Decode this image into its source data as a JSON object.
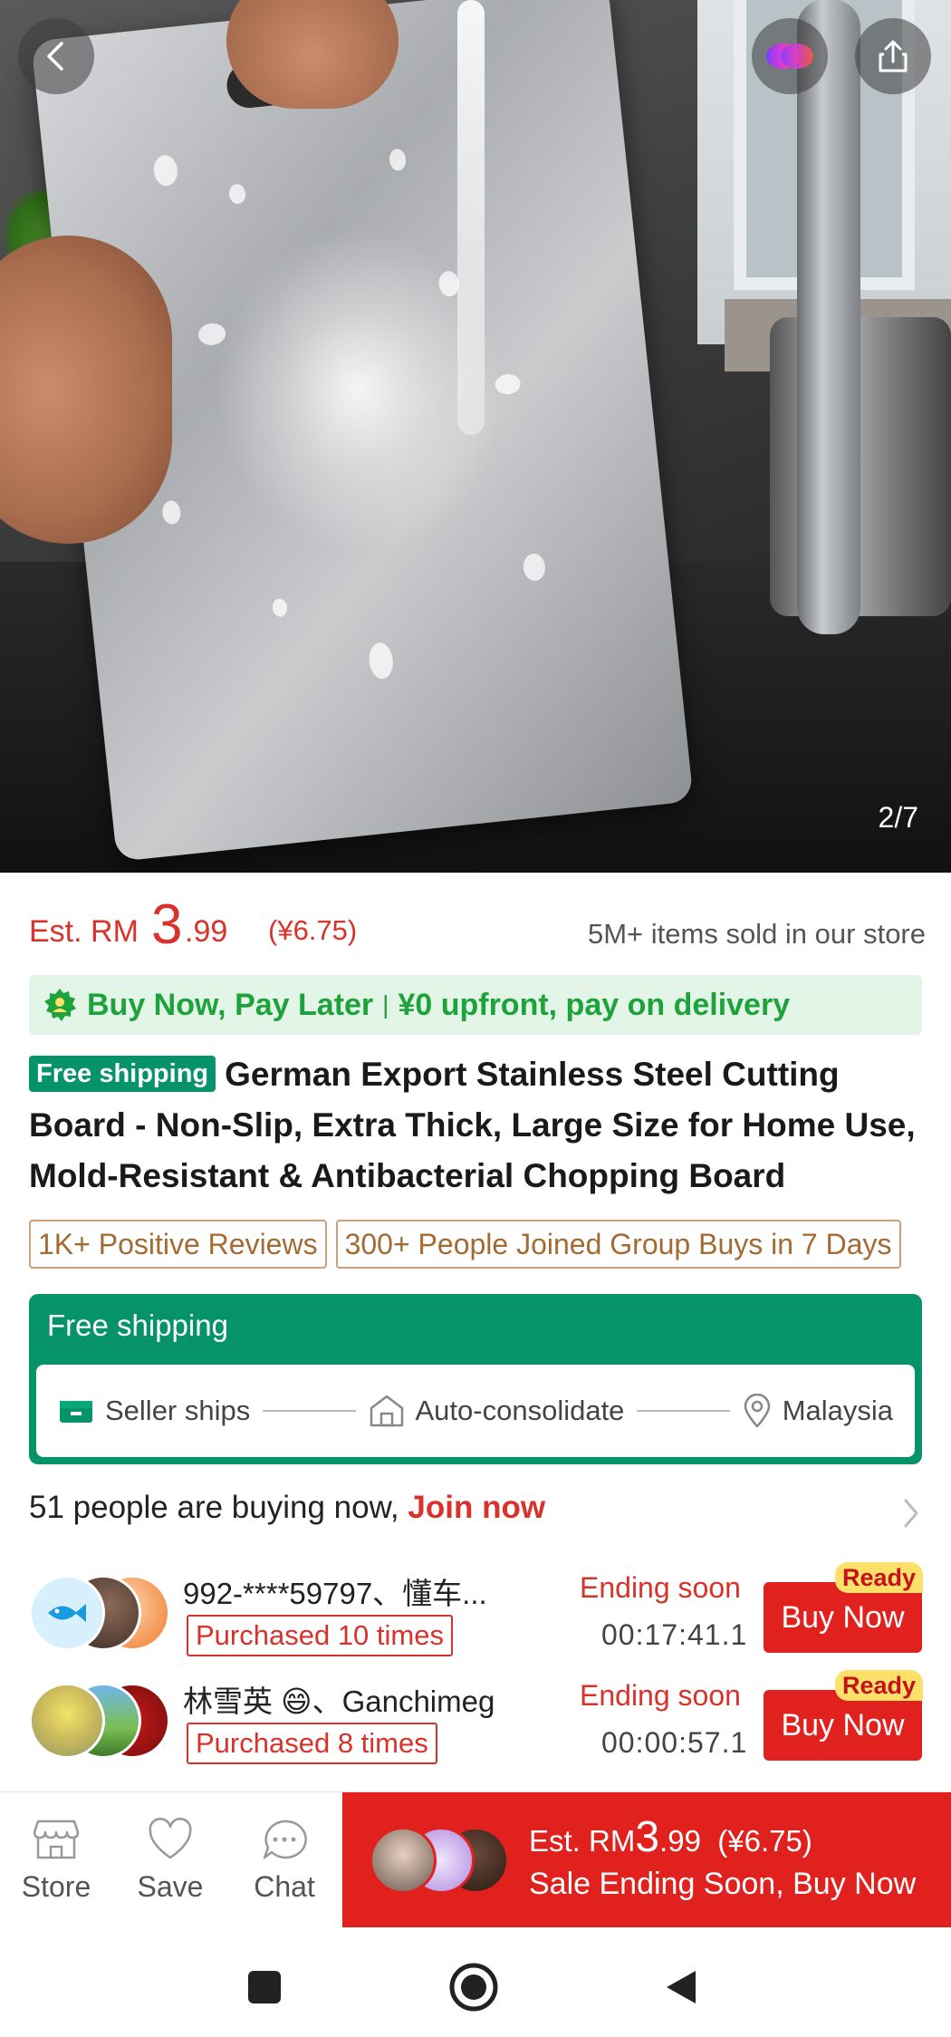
{
  "gallery": {
    "counter": "2/7"
  },
  "price": {
    "est_prefix": "Est. RM",
    "integer": "3",
    "decimal": ".99",
    "cny": "(¥6.75)",
    "sold": "5M+ items sold in our store"
  },
  "bnpl": {
    "part1": "Buy Now, Pay Later",
    "separator": "|",
    "part2": "¥0 upfront, pay on delivery"
  },
  "product": {
    "badge": "Free shipping",
    "title": "German Export Stainless Steel Cutting Board - Non-Slip, Extra Thick, Large Size for Home Use, Mold-Resistant & Antibacterial Chopping Board"
  },
  "tags": [
    "1K+ Positive Reviews",
    "300+ People Joined Group Buys in 7 Days"
  ],
  "shipping": {
    "title": "Free shipping",
    "steps": [
      "Seller ships",
      "Auto-consolidate",
      "Malaysia"
    ]
  },
  "buying_now": {
    "text": "51 people are buying now, ",
    "join": "Join now"
  },
  "groups": [
    {
      "names": "992-****59797、懂车...",
      "purchased": "Purchased 10 times",
      "ending": "Ending soon",
      "timer": "00:17:41.1",
      "button": "Buy Now",
      "ready": "Ready"
    },
    {
      "names": "林雪英 😄、Ganchimeg",
      "purchased": "Purchased 8 times",
      "ending": "Ending soon",
      "timer": "00:00:57.1",
      "button": "Buy Now",
      "ready": "Ready"
    }
  ],
  "action_bar": {
    "store": "Store",
    "save": "Save",
    "chat": "Chat",
    "cta_prefix": "Est. RM",
    "cta_big": "3",
    "cta_dec": ".99",
    "cta_cny": "(¥6.75)",
    "cta_line2": "Sale Ending Soon, Buy Now"
  },
  "colors": {
    "price_red": "#d8322b",
    "brand_green": "#07936a",
    "bnpl_green": "#1ea33c",
    "button_red": "#e0211e"
  },
  "icons": [
    "back-icon",
    "ai-assistant-icon",
    "share-icon",
    "bnpl-icon",
    "truck-icon",
    "warehouse-icon",
    "location-icon",
    "chevron-right-icon",
    "store-icon",
    "heart-icon",
    "chat-icon",
    "recents-icon",
    "home-icon",
    "back-nav-icon"
  ]
}
